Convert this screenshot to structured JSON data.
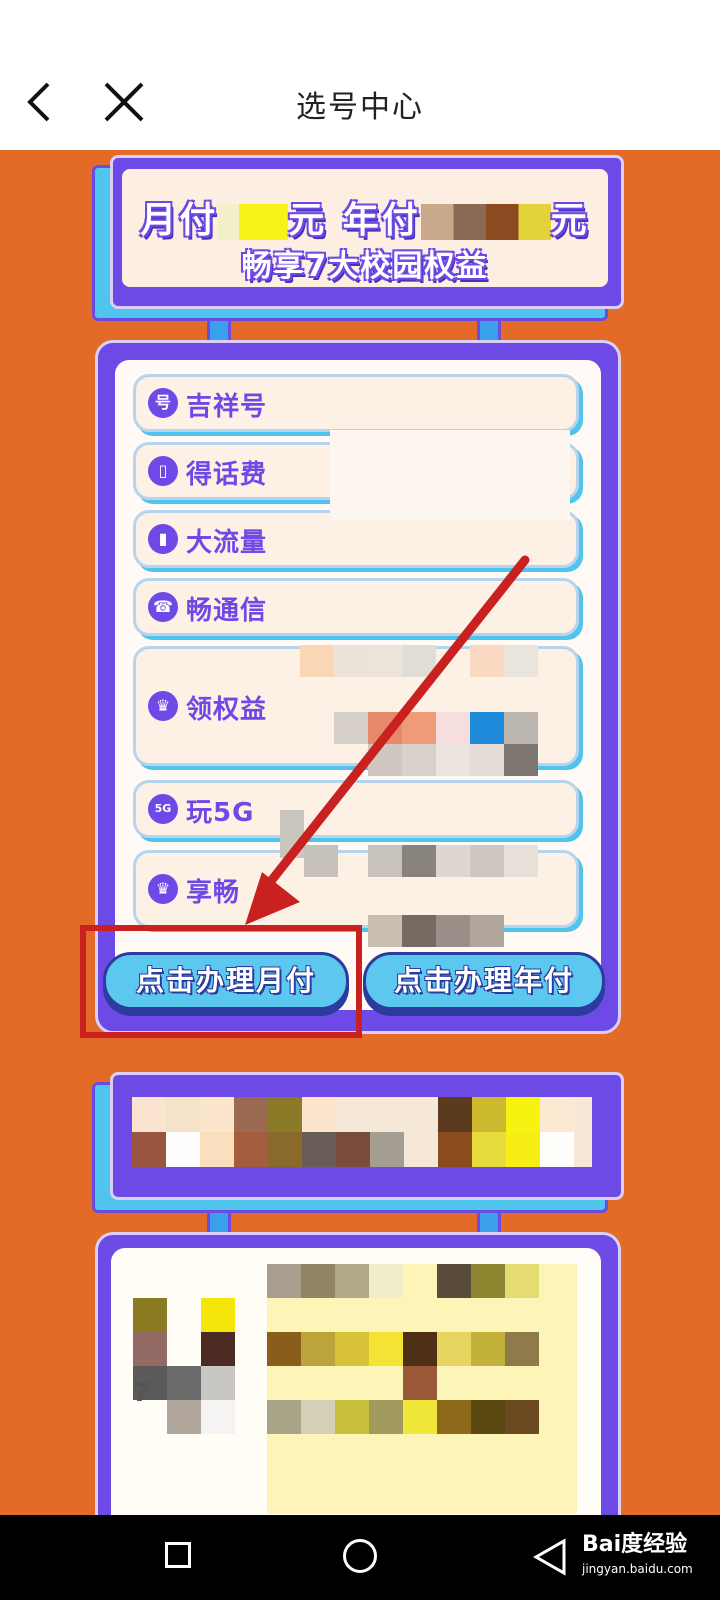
{
  "header": {
    "title": "选号中心",
    "back_icon": "chevron-left-icon",
    "close_icon": "close-icon"
  },
  "banner": {
    "monthly_prefix": "月付",
    "monthly_suffix": "元",
    "yearly_prefix": "年付",
    "yearly_suffix": "元",
    "subtitle": "畅享7大校园权益"
  },
  "benefits": [
    {
      "icon": "号",
      "label": "吉祥号"
    },
    {
      "icon": "▯",
      "label": "得话费"
    },
    {
      "icon": "▮",
      "label": "大流量"
    },
    {
      "icon": "☎",
      "label": "畅通信"
    },
    {
      "icon": "♛",
      "label": "领权益"
    },
    {
      "icon": "5G",
      "label": "玩5G"
    },
    {
      "icon": "♛",
      "label": "享畅"
    }
  ],
  "buttons": {
    "monthly": "点击办理月付",
    "yearly": "点击办理年付"
  },
  "second_card": {
    "left_text": "7"
  },
  "navbar": {
    "watermark": "Bai度经验",
    "watermark_sub": "jingyan.baidu.com"
  },
  "colors": {
    "background": "#e46a27",
    "accent_purple": "#6d49e6",
    "button_blue": "#5cc8f0",
    "highlight_red": "#c8211f"
  }
}
